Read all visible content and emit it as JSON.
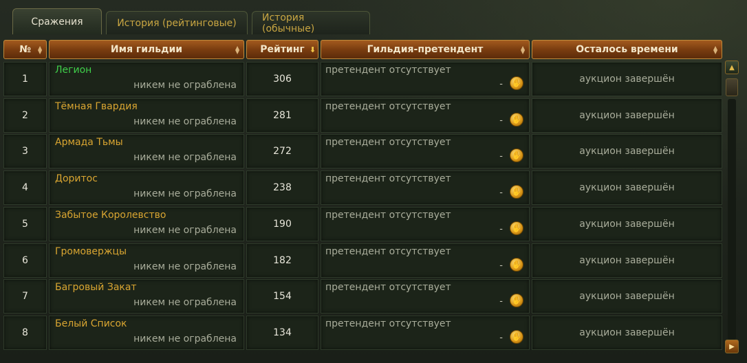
{
  "tabs": [
    {
      "label": "Сражения",
      "active": true
    },
    {
      "label": "История (рейтинговые)",
      "active": false
    },
    {
      "label": "История (обычные)",
      "active": false
    }
  ],
  "columns": {
    "number": "№",
    "guild_name": "Имя гильдии",
    "rating": "Рейтинг",
    "challenger": "Гильдия-претендент",
    "time_left": "Осталось времени"
  },
  "rows": [
    {
      "num": "1",
      "name": "Легион",
      "name_color": "#3fcf4a",
      "status": "никем не ограблена",
      "rating": "306",
      "challenger": "претендент отсутствует",
      "bid": "-",
      "time": "аукцион завершён"
    },
    {
      "num": "2",
      "name": "Тёмная Гвардия",
      "name_color": "#d9a531",
      "status": "никем не ограблена",
      "rating": "281",
      "challenger": "претендент отсутствует",
      "bid": "-",
      "time": "аукцион завершён"
    },
    {
      "num": "3",
      "name": "Армада Тьмы",
      "name_color": "#d9a531",
      "status": "никем не ограблена",
      "rating": "272",
      "challenger": "претендент отсутствует",
      "bid": "-",
      "time": "аукцион завершён"
    },
    {
      "num": "4",
      "name": "Доритос",
      "name_color": "#d9a531",
      "status": "никем не ограблена",
      "rating": "238",
      "challenger": "претендент отсутствует",
      "bid": "-",
      "time": "аукцион завершён"
    },
    {
      "num": "5",
      "name": "Забытое Королевство",
      "name_color": "#d9a531",
      "status": "никем не ограблена",
      "rating": "190",
      "challenger": "претендент отсутствует",
      "bid": "-",
      "time": "аукцион завершён"
    },
    {
      "num": "6",
      "name": "Громовержцы",
      "name_color": "#d9a531",
      "status": "никем не ограблена",
      "rating": "182",
      "challenger": "претендент отсутствует",
      "bid": "-",
      "time": "аукцион завершён"
    },
    {
      "num": "7",
      "name": "Багровый Закат",
      "name_color": "#d9a531",
      "status": "никем не ограблена",
      "rating": "154",
      "challenger": "претендент отсутствует",
      "bid": "-",
      "time": "аукцион завершён"
    },
    {
      "num": "8",
      "name": "Белый Список",
      "name_color": "#d9a531",
      "status": "никем не ограблена",
      "rating": "134",
      "challenger": "претендент отсутствует",
      "bid": "-",
      "time": "аукцион завершён"
    }
  ],
  "icons": {
    "coin": "gold-coin-icon",
    "sort_active": "sort-down-arrow-icon",
    "sort_inactive": "sort-up-down-icon"
  },
  "colors": {
    "header_bg": "#7a3d10",
    "accent_gold": "#d9a531",
    "guild_highlight": "#3fcf4a"
  }
}
